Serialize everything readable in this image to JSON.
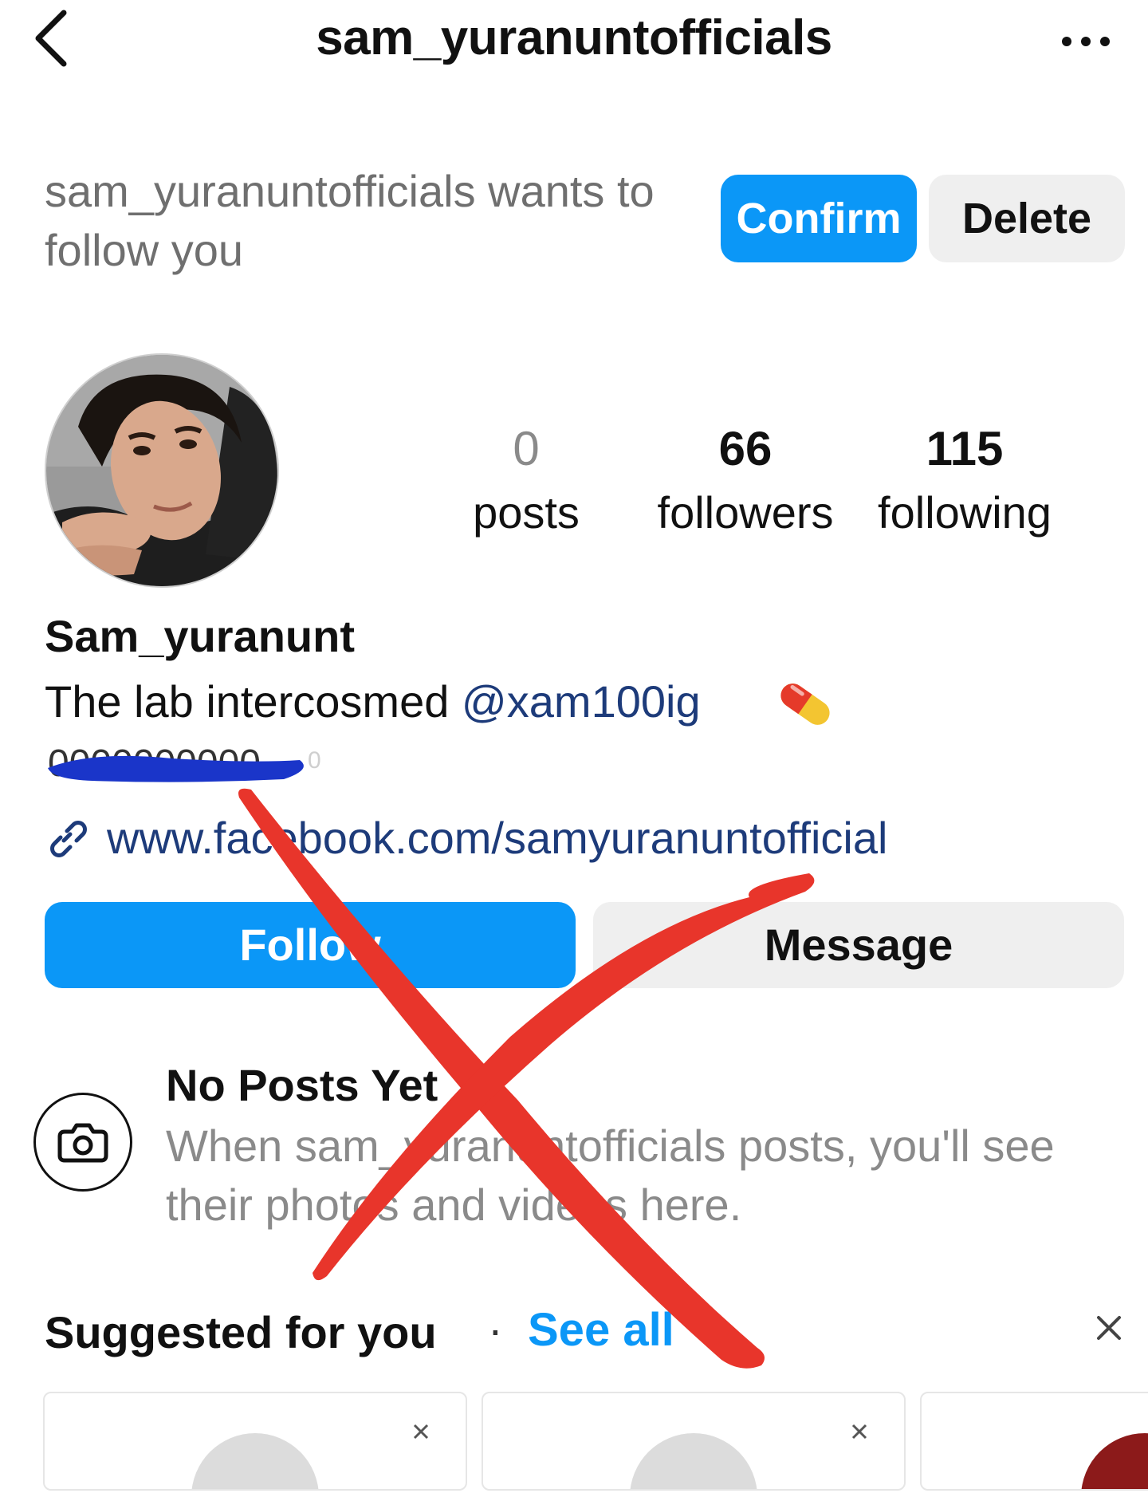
{
  "header": {
    "title": "sam_yuranuntofficials"
  },
  "follow_request": {
    "text": "sam_yuranuntofficials wants to follow you",
    "confirm_label": "Confirm",
    "delete_label": "Delete"
  },
  "stats": {
    "posts_count": "0",
    "posts_label": "posts",
    "followers_count": "66",
    "followers_label": "followers",
    "following_count": "115",
    "following_label": "following"
  },
  "profile": {
    "display_name": "Sam_yuranunt",
    "bio_text": "The lab intercosmed ",
    "bio_mention": "@xam100ig",
    "link": "www.facebook.com/samyuranuntofficial"
  },
  "actions": {
    "follow_label": "Follow",
    "message_label": "Message"
  },
  "empty_state": {
    "title": "No Posts Yet",
    "text": "When sam_yuranuntofficials posts, you'll see their photos and videos here."
  },
  "suggested": {
    "title": "Suggested for you",
    "separator": "·",
    "see_all_label": "See all"
  },
  "colors": {
    "accent": "#0b97f7",
    "secondary_button": "#efefef",
    "link": "#1d3b7a",
    "muted_text": "#8a8a8a",
    "annotation_red": "#e8352b"
  },
  "icons": {
    "back": "chevron-left-icon",
    "more": "more-horizontal-icon",
    "link": "link-icon",
    "camera": "camera-icon",
    "close": "close-icon"
  }
}
